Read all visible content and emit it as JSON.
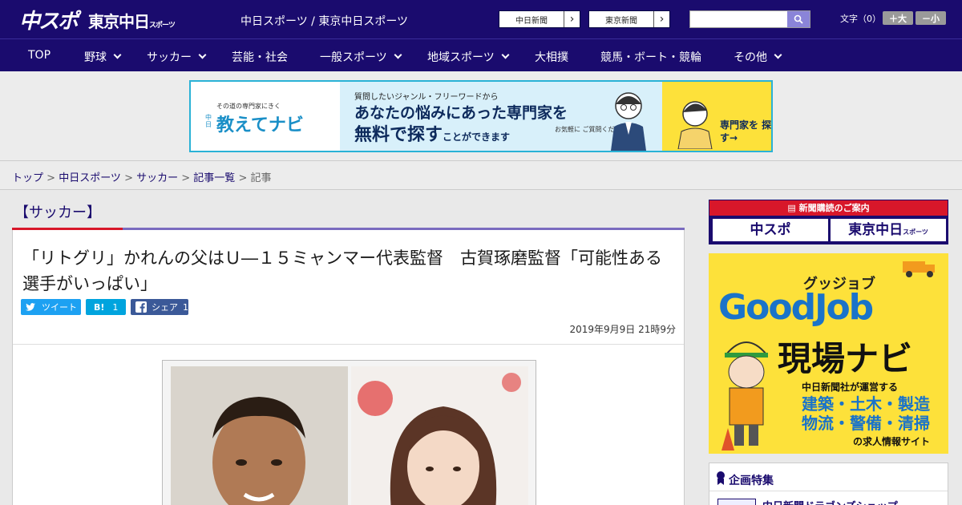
{
  "header": {
    "logo_chuspo": "中スポ",
    "logo_tokyo": "東京中日",
    "logo_tokyo_small": "スポーツ",
    "site_title": "中日スポーツ / 東京中日スポーツ",
    "paper_links": [
      "中日新聞",
      "東京新聞"
    ],
    "font_size_label": "文字（0）",
    "font_big": "＋大",
    "font_small": "－小",
    "search_placeholder": ""
  },
  "nav": {
    "items": [
      {
        "label": "TOP"
      },
      {
        "label": "野球"
      },
      {
        "label": "サッカー"
      },
      {
        "label": "芸能・社会"
      },
      {
        "label": "一般スポーツ"
      },
      {
        "label": "地域スポーツ"
      },
      {
        "label": "大相撲"
      },
      {
        "label": "競馬・ボート・競輪"
      },
      {
        "label": "その他"
      }
    ]
  },
  "banner": {
    "tagline": "その道の専門家にきく",
    "logo": "教えてナビ",
    "logo_prefix": "中日",
    "line1": "質問したいジャンル・フリーワードから",
    "line2": "あなたの悩みにあった専門家を",
    "line3_big": "無料で探す",
    "line3_small": "ことができます",
    "note": "お気軽に ご質問ください！",
    "cta": "専門家を 探す→"
  },
  "breadcrumb": {
    "items": [
      "トップ",
      "中日スポーツ",
      "サッカー",
      "記事一覧"
    ],
    "current": "記事",
    "sep": " > "
  },
  "article": {
    "category": "【サッカー】",
    "title": "「リトグリ」かれんの父はＵ―１５ミャンマー代表監督　古賀琢磨監督「可能性ある選手がいっぱい」",
    "share": {
      "tweet": "ツイート",
      "hatena": "B!",
      "hatena_count": "1",
      "facebook": "シェア",
      "facebook_count": "1"
    },
    "date": "2019年9月9日 21時9分"
  },
  "sidebar": {
    "subscribe_header": "新聞購読のご案内",
    "subscribe_buttons": [
      "中スポ",
      "東京中日"
    ],
    "subscribe_small": "スポーツ",
    "ad_kana": "グッジョブ",
    "ad_brand": "GoodJob",
    "ad_title": "現場ナビ",
    "ad_line1": "中日新聞社が運営する",
    "ad_line2": "建築・土木・製造",
    "ad_line3": "物流・警備・清掃",
    "ad_line4": "の求人情報サイト",
    "feature_header": "企画特集",
    "feature_item": "中日新聞ドラゴンズショップ"
  },
  "colors": {
    "brand": "#1a0b6e",
    "accent_red": "#d8172a",
    "twitter": "#1da1f2",
    "hatena": "#00a4de",
    "facebook": "#3b5998"
  }
}
